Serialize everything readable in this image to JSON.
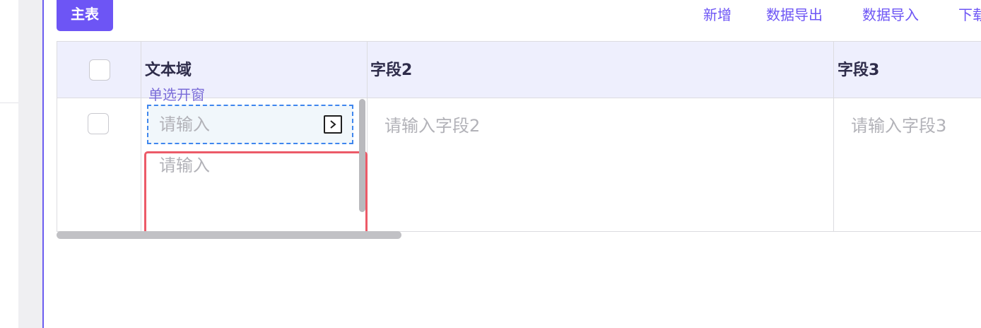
{
  "main_tab": {
    "label": "主表"
  },
  "toolbar": {
    "add_label": "新增",
    "export_label": "数据导出",
    "import_label": "数据导入",
    "download_label": "下载"
  },
  "table": {
    "columns": [
      {
        "key": "text_field",
        "label": "文本域"
      },
      {
        "key": "field2",
        "label": "字段2"
      },
      {
        "key": "field3",
        "label": "字段3"
      }
    ],
    "row": {
      "popup_caption": "单选开窗",
      "popup_placeholder": "请输入",
      "textarea_placeholder": "请输入",
      "field2_placeholder": "请输入字段2",
      "field3_placeholder": "请输入字段3"
    }
  },
  "icons": {
    "popup_icon": "chevron-right-box-icon"
  },
  "colors": {
    "accent": "#6d55f5",
    "header_bg": "#eeeffd",
    "focus_dashed": "#3f86ee",
    "error_border": "#ec5a68"
  }
}
